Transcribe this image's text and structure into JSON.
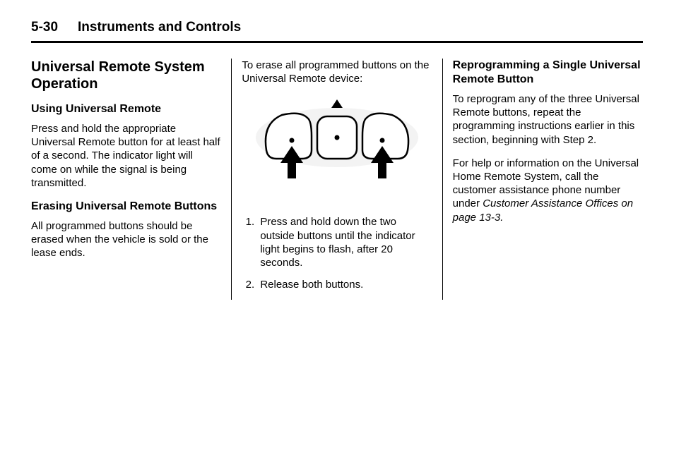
{
  "header": {
    "page_number": "5-30",
    "chapter_title": "Instruments and Controls"
  },
  "col1": {
    "section_title": "Universal Remote System Operation",
    "sub1_title": "Using Universal Remote",
    "sub1_body": "Press and hold the appropriate Universal Remote button for at least half of a second. The indicator light will come on while the signal is being transmitted.",
    "sub2_title": "Erasing Universal Remote Buttons",
    "sub2_body": "All programmed buttons should be erased when the vehicle is sold or the lease ends."
  },
  "col2": {
    "intro": "To erase all programmed buttons on the Universal Remote device:",
    "step1": "Press and hold down the two outside buttons until the indicator light begins to flash, after 20 seconds.",
    "step2": "Release both buttons."
  },
  "col3": {
    "sub_title": "Reprogramming a Single Universal Remote Button",
    "p1": "To reprogram any of the three Universal Remote buttons, repeat the programming instructions earlier in this section, beginning with Step 2.",
    "p2_a": "For help or information on the Universal Home Remote System, call the customer assistance phone number under ",
    "p2_ref": "Customer Assistance Offices on page 13-3.",
    "p2_c": ""
  }
}
